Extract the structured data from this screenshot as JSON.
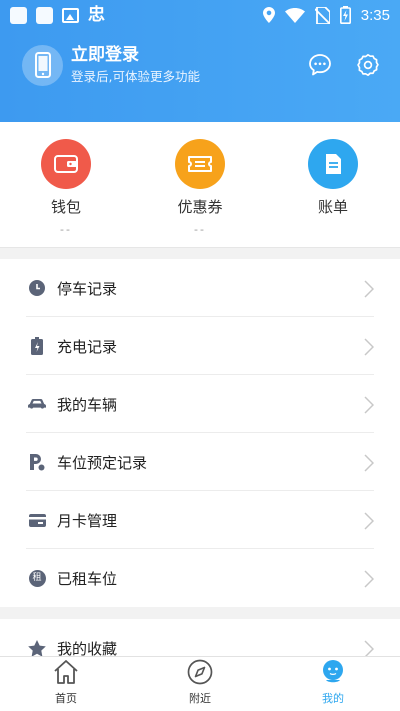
{
  "status_bar": {
    "time": "3:35"
  },
  "header": {
    "login_title": "立即登录",
    "login_subtitle": "登录后,可体验更多功能"
  },
  "quick_actions": [
    {
      "label": "钱包",
      "sub": "--",
      "color": "#f05a4a",
      "icon": "wallet-icon"
    },
    {
      "label": "优惠券",
      "sub": "--",
      "color": "#f7a21b",
      "icon": "coupon-icon"
    },
    {
      "label": "账单",
      "sub": "",
      "color": "#2ea7ef",
      "icon": "bill-icon"
    }
  ],
  "menu": [
    {
      "label": "停车记录",
      "icon": "clock-icon"
    },
    {
      "label": "充电记录",
      "icon": "battery-charge-icon"
    },
    {
      "label": "我的车辆",
      "icon": "car-icon"
    },
    {
      "label": "车位预定记录",
      "icon": "parking-reserve-icon"
    },
    {
      "label": "月卡管理",
      "icon": "card-icon"
    },
    {
      "label": "已租车位",
      "icon": "rent-badge-icon",
      "badge": "租"
    }
  ],
  "menu_secondary": [
    {
      "label": "我的收藏",
      "icon": "star-icon"
    }
  ],
  "tabs": [
    {
      "label": "首页",
      "icon": "home-icon"
    },
    {
      "label": "附近",
      "icon": "compass-icon"
    },
    {
      "label": "我的",
      "icon": "profile-icon",
      "active": true
    }
  ],
  "colors": {
    "header": "#3d9af0",
    "active_tab": "#2ea7ef",
    "menu_icon": "#5b6478"
  }
}
